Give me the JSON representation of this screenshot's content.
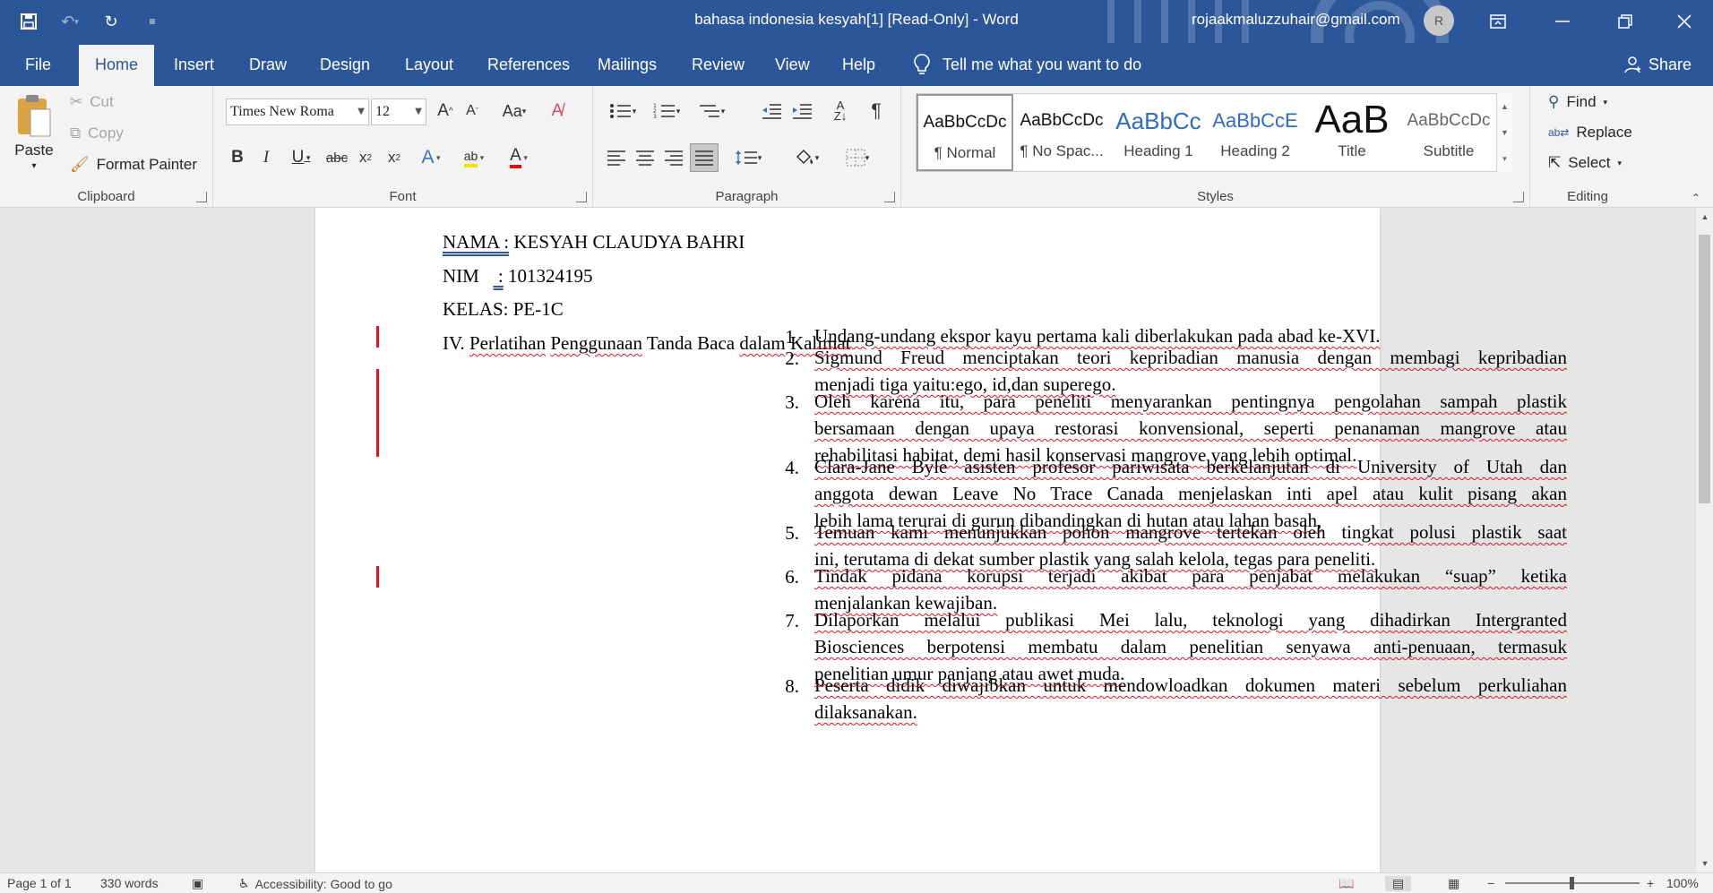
{
  "window": {
    "title": "bahasa indonesia kesyah[1] [Read-Only]  -  Word",
    "user_email": "rojaakmaluzzuhair@gmail.com",
    "avatar_initial": "R"
  },
  "tabs": [
    {
      "label": "File"
    },
    {
      "label": "Home"
    },
    {
      "label": "Insert"
    },
    {
      "label": "Draw"
    },
    {
      "label": "Design"
    },
    {
      "label": "Layout"
    },
    {
      "label": "References"
    },
    {
      "label": "Mailings"
    },
    {
      "label": "Review"
    },
    {
      "label": "View"
    },
    {
      "label": "Help"
    }
  ],
  "active_tab": "Home",
  "tell_me": "Tell me what you want to do",
  "share_label": "Share",
  "ribbon": {
    "clipboard": {
      "paste": "Paste",
      "cut": "Cut",
      "copy": "Copy",
      "format_painter": "Format Painter",
      "label": "Clipboard"
    },
    "font": {
      "name": "Times New Roma",
      "size": "12",
      "label": "Font"
    },
    "paragraph": {
      "label": "Paragraph"
    },
    "styles": {
      "label": "Styles",
      "items": [
        {
          "preview": "AaBbCcDc",
          "name": "¶ Normal"
        },
        {
          "preview": "AaBbCcDc",
          "name": "¶ No Spac..."
        },
        {
          "preview": "AaBbCc",
          "name": "Heading 1"
        },
        {
          "preview": "AaBbCcE",
          "name": "Heading 2"
        },
        {
          "preview": "AaB",
          "name": "Title"
        },
        {
          "preview": "AaBbCcDc",
          "name": "Subtitle"
        }
      ]
    },
    "editing": {
      "find": "Find",
      "replace": "Replace",
      "select": "Select",
      "label": "Editing"
    }
  },
  "document": {
    "nama_label": "NAMA :",
    "nama_value": " KESYAH CLAUDYA BAHRI",
    "nim_label": "NIM",
    "nim_colon": " :",
    "nim_value": " 101324195",
    "kelas": "KELAS: PE-1C",
    "section_title_prefix": "IV. ",
    "section_title_words": [
      "Perlatihan",
      "Penggunaan",
      "Tanda",
      "Baca",
      "dalam",
      "Kalimat"
    ],
    "list": [
      {
        "num": "1.",
        "lines": [
          "Undang-undang ekspor kayu pertama kali diberlakukan pada abad ke-XVI."
        ]
      },
      {
        "num": "2.",
        "lines": [
          "Sigmund Freud menciptakan teori kepribadian manusia dengan membagi kepribadian",
          "menjadi tiga yaitu:ego,  id,dan superego."
        ]
      },
      {
        "num": "3.",
        "lines": [
          "Oleh karena itu, para peneliti menyarankan pentingnya pengolahan sampah plastik",
          "bersamaan dengan upaya restorasi konvensional, seperti penanaman mangrove atau",
          "rehabilitasi habitat, demi hasil konservasi mangrove yang lebih optimal."
        ]
      },
      {
        "num": "4.",
        "lines": [
          "Clara-Jane Byle asisten profesor pariwisata berkelanjutan di University of  Utah dan",
          "anggota dewan Leave No Trace Canada menjelaskan inti apel atau kulit pisang akan",
          "lebih lama terurai di gurun dibandingkan di hutan atau lahan basah,"
        ]
      },
      {
        "num": "5.",
        "lines": [
          "Temuan kami menunjukkan pohon mangrove tertekan oleh tingkat polusi plastik saat",
          "ini, terutama di dekat sumber plastik yang salah kelola, tegas para peneliti."
        ]
      },
      {
        "num": "6.",
        "lines": [
          "Tindak pidana korupsi terjadi akibat para penjabat melakukan  “suap” ketika",
          "menjalankan kewajiban."
        ]
      },
      {
        "num": "7.",
        "lines": [
          "Dilaporkan melalui publikasi Mei lalu, teknologi yang dihadirkan Intergranted",
          "Biosciences berpotensi membatu dalam penelitian senyawa anti-penuaan, termasuk",
          "penelitian umur panjang atau awet muda."
        ]
      },
      {
        "num": "8.",
        "lines": [
          "Peserta didik diwajibkan untuk mendowloadkan dokumen materi sebelum perkuliahan",
          "dilaksanakan."
        ]
      }
    ]
  },
  "status": {
    "page": "Page 1 of 1",
    "words": "330 words",
    "accessibility": "Accessibility: Good to go",
    "zoom": "100%"
  },
  "colors": {
    "brand": "#2b579a",
    "squiggle": "#e81123"
  }
}
